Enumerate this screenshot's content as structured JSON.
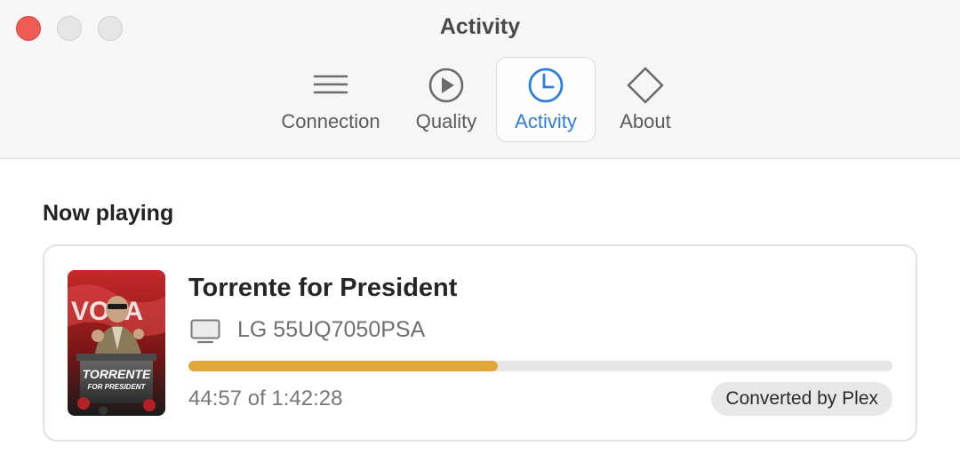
{
  "window": {
    "title": "Activity"
  },
  "toolbar": {
    "tabs": [
      {
        "label": "Connection",
        "icon": "menu-lines-icon",
        "selected": false
      },
      {
        "label": "Quality",
        "icon": "play-circle-icon",
        "selected": false
      },
      {
        "label": "Activity",
        "icon": "clock-icon",
        "selected": true
      },
      {
        "label": "About",
        "icon": "diamond-icon",
        "selected": false
      }
    ]
  },
  "main": {
    "section_title": "Now playing",
    "now_playing": {
      "title": "Torrente for President",
      "device_icon": "monitor-icon",
      "device": "LG 55UQ7050PSA",
      "progress_fraction": 0.44,
      "time_text": "44:57 of 1:42:28",
      "badge": "Converted by Plex",
      "poster": {
        "main_text": "TORRENTE",
        "sub_text": "FOR PRESIDENT",
        "bg_text": "VOTA"
      }
    }
  },
  "colors": {
    "accent": "#2f7de1",
    "progress": "#e2a73a",
    "close_button": "#ee5b55",
    "poster_red": "#c72929"
  }
}
